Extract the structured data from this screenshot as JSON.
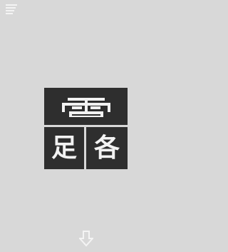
{
  "toolbar": {
    "menu_icon": "menu-lines-icon"
  },
  "tiles": {
    "top": {
      "character": "雷",
      "style": "stretched-wide"
    },
    "bottom_left": {
      "character": "足"
    },
    "bottom_right": {
      "character": "各"
    }
  },
  "footer": {
    "arrow_icon": "down-arrow-icon"
  },
  "colors": {
    "background": "#d8d8d8",
    "tile": "#2e2e2e",
    "tile_text": "#f2f2f2",
    "icon": "#f4f4f4"
  }
}
